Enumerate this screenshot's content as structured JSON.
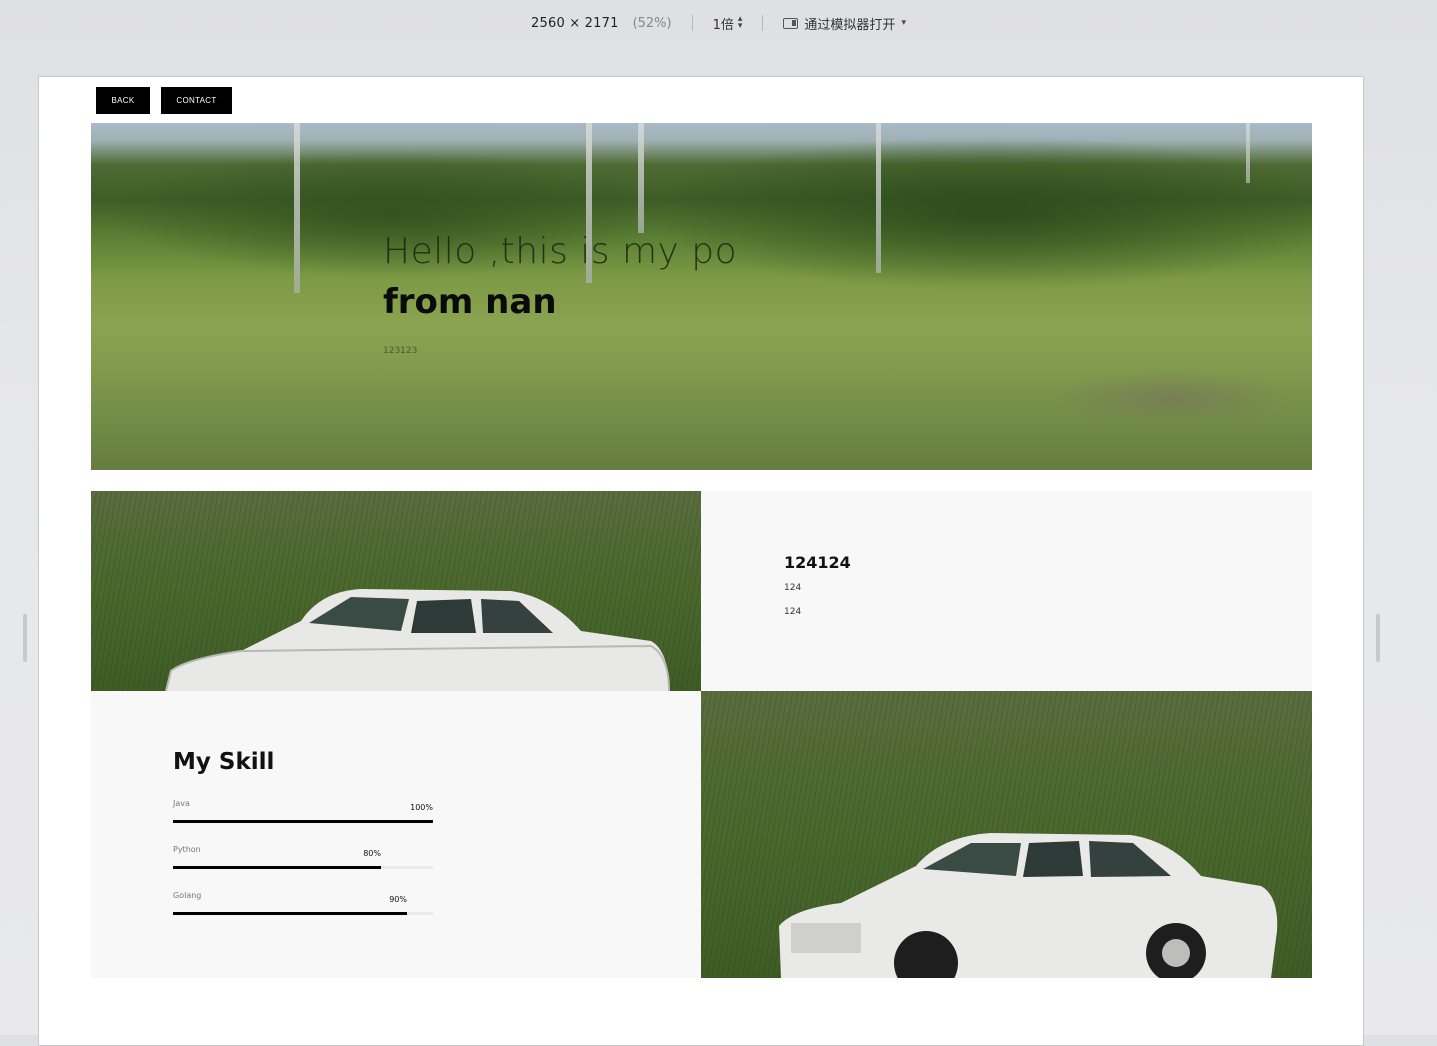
{
  "toolbar": {
    "dimensions": "2560 × 2171",
    "scale_percent": "(52%)",
    "zoom": "1倍",
    "open_in_simulator": "通过模拟器打开"
  },
  "nav": {
    "back_label": "BACK",
    "contact_label": "CONTACT"
  },
  "hero": {
    "line1": "Hello ,this is my po",
    "line2": "from nan",
    "subtitle": "123123"
  },
  "info": {
    "title": "124124",
    "line1": "124",
    "line2": "124"
  },
  "skills": {
    "title": "My Skill",
    "items": [
      {
        "name": "Java",
        "percent_label": "100%",
        "level": 1.0
      },
      {
        "name": "Python",
        "percent_label": "80%",
        "level": 0.8
      },
      {
        "name": "Golang",
        "percent_label": "90%",
        "level": 0.9
      }
    ]
  },
  "colors": {
    "button_bg": "#000000",
    "panel_bg": "#f8f8f8",
    "skill_bar": "#000000"
  },
  "icons": [
    "sort-updown-icon",
    "simulator-icon",
    "chevron-down-icon"
  ]
}
